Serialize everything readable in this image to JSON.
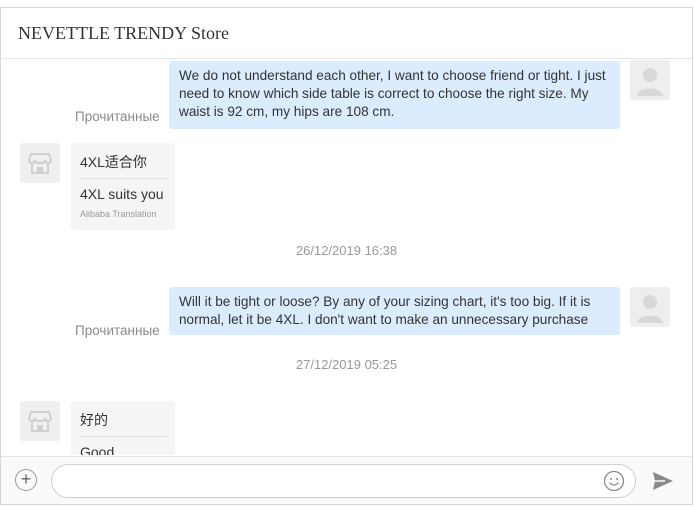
{
  "header": {
    "title": "NEVETTLE TRENDY Store"
  },
  "messages": {
    "m1": {
      "text": "We do not understand each other, I want to choose friend or tight. I just need to know which side table is correct to choose the right size. My waist is 92 cm, my hips are 108 cm.",
      "status": "Прочитанные"
    },
    "m2": {
      "original": "4XL适合你",
      "translation": "4XL suits you",
      "provider": "Alibaba Translation"
    },
    "ts1": "26/12/2019 16:38",
    "m3": {
      "text": "Will it be tight or loose? By any of your sizing chart, it's too big. If it is normal, let it be 4XL. I don't want to make an unnecessary purchase",
      "status": "Прочитанные"
    },
    "ts2": "27/12/2019 05:25",
    "m4": {
      "original": "好的",
      "translation": "Good"
    }
  },
  "composer": {
    "value": "",
    "placeholder": ""
  },
  "icons": {
    "add": "plus-circle-icon",
    "emoji": "smiley-icon",
    "send": "paper-plane-icon",
    "store_avatar": "storefront-icon",
    "user_avatar": "user-silhouette-icon"
  },
  "colors": {
    "outgoing_bubble": "#dcecff",
    "incoming_bubble": "#f5f5f5",
    "read_status": "#8a8a8a"
  }
}
